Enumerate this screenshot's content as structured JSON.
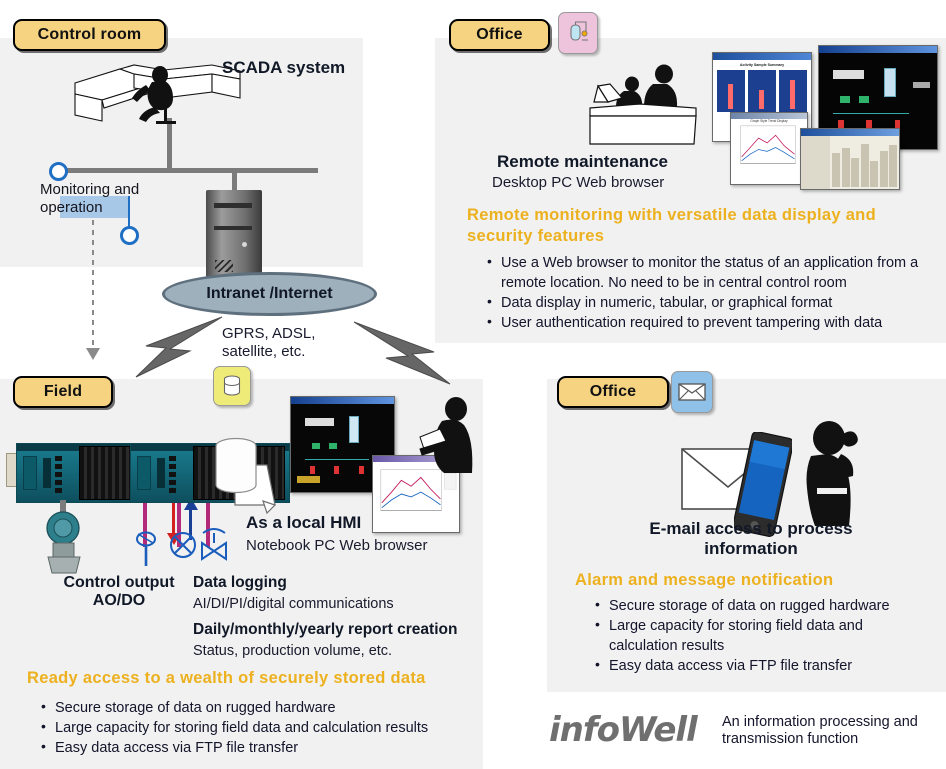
{
  "colors": {
    "tag_bg": "#f5d380",
    "panel_bg": "#f0f1f0",
    "gold_heading": "#edb11f",
    "badge_process": "#eec4dd",
    "badge_db": "#efeb79",
    "badge_mail": "#8ec0e8",
    "ellipse_fill": "#9fb0bd",
    "selection_blue": "#1f6fc4",
    "logo_gray": "#6f6f6f"
  },
  "control_room": {
    "tag": "Control room",
    "scada_label": "SCADA system",
    "monitoring_label_line1": "Monitoring and",
    "monitoring_label_line2": "operation",
    "icons": {
      "desk": "operator-desk-icon",
      "server": "server-tower-icon",
      "handle": "selection-handle-icon"
    }
  },
  "network": {
    "ellipse_label": "Intranet /Internet",
    "link_types_line1": "GPRS, ADSL,",
    "link_types_line2": "satellite, etc.",
    "bolt_icon": "lightning-bolt-icon",
    "db_badge_icon": "database-cylinder-icon"
  },
  "office_top": {
    "tag": "Office",
    "badge_icon": "process-tank-icon",
    "caption_title": "Remote maintenance",
    "caption_sub": "Desktop PC Web browser",
    "gold_heading": "Remote monitoring with versatile data display and security features",
    "bullets": [
      "Use a Web browser to monitor the status of an application from a remote location. No need to be in central control room",
      "Data display in numeric, tabular, or graphical format",
      "User authentication required to prevent tampering with data"
    ],
    "screenshot_titles": [
      "Activity Sample Summary",
      "Graph Style Trend Display"
    ]
  },
  "field": {
    "tag": "Field",
    "badge_icon": "database-cylinder-icon",
    "hmi_title": "As a local HMI",
    "hmi_sub": "Notebook PC Web browser",
    "control_output_line1": "Control output",
    "control_output_line2": "AO/DO",
    "data_logging_title": "Data logging",
    "data_logging_sub": "AI/DI/PI/digital communications",
    "report_title": "Daily/monthly/yearly report creation",
    "report_sub": "Status, production volume, etc.",
    "gold_heading": "Ready access to a wealth of securely stored data",
    "bullets": [
      "Secure storage of data on rugged hardware",
      "Large capacity for storing field data and calculation results",
      "Easy data access via FTP file transfer"
    ],
    "icons": {
      "plc": "plc-controller-icon",
      "transmitter": "pressure-transmitter-icon",
      "sensor": "temperature-sensor-icon",
      "flowmeter": "flow-meter-icon",
      "valve": "control-valve-icon",
      "db_cylinder": "database-cylinder-icon",
      "document": "document-page-icon",
      "engineer": "engineer-with-laptop-icon"
    }
  },
  "office_bottom": {
    "tag": "Office",
    "badge_icon": "envelope-icon",
    "caption_line1": "E-mail access to process",
    "caption_line2": "information",
    "gold_heading": "Alarm and message notification",
    "bullets": [
      "Secure storage of data on rugged hardware",
      "Large capacity for storing field data and calculation results",
      "Easy data access via FTP file transfer"
    ],
    "icons": {
      "envelope": "envelope-icon",
      "smartphone": "smartphone-icon",
      "person": "person-on-phone-icon"
    }
  },
  "footer": {
    "logo_text": "infoWell",
    "logo_desc_line1": "An information processing and",
    "logo_desc_line2": "transmission function"
  }
}
